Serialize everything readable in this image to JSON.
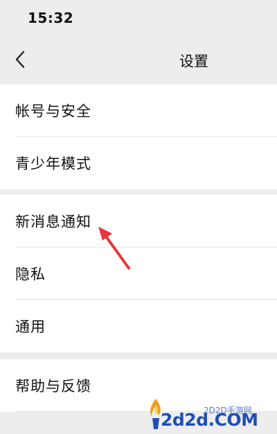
{
  "status_bar": {
    "time": "15:32"
  },
  "nav": {
    "title": "设置",
    "back_icon": "chevron-left-icon"
  },
  "groups": [
    {
      "items": [
        {
          "label": "帐号与安全"
        },
        {
          "label": "青少年模式"
        }
      ]
    },
    {
      "items": [
        {
          "label": "新消息通知"
        },
        {
          "label": "隐私"
        },
        {
          "label": "通用"
        }
      ]
    },
    {
      "items": [
        {
          "label": "帮助与反馈"
        }
      ]
    }
  ],
  "annotation": {
    "icon": "red-arrow-icon",
    "color": "#e8343a"
  },
  "watermark": {
    "site": "2d2d.COM",
    "name": "2D2D手游网",
    "icon": "flame-logo-icon"
  },
  "colors": {
    "background": "#ededed",
    "cell": "#ffffff",
    "divider": "#e5e5e5",
    "watermark_blue": "#1e4fb5"
  }
}
